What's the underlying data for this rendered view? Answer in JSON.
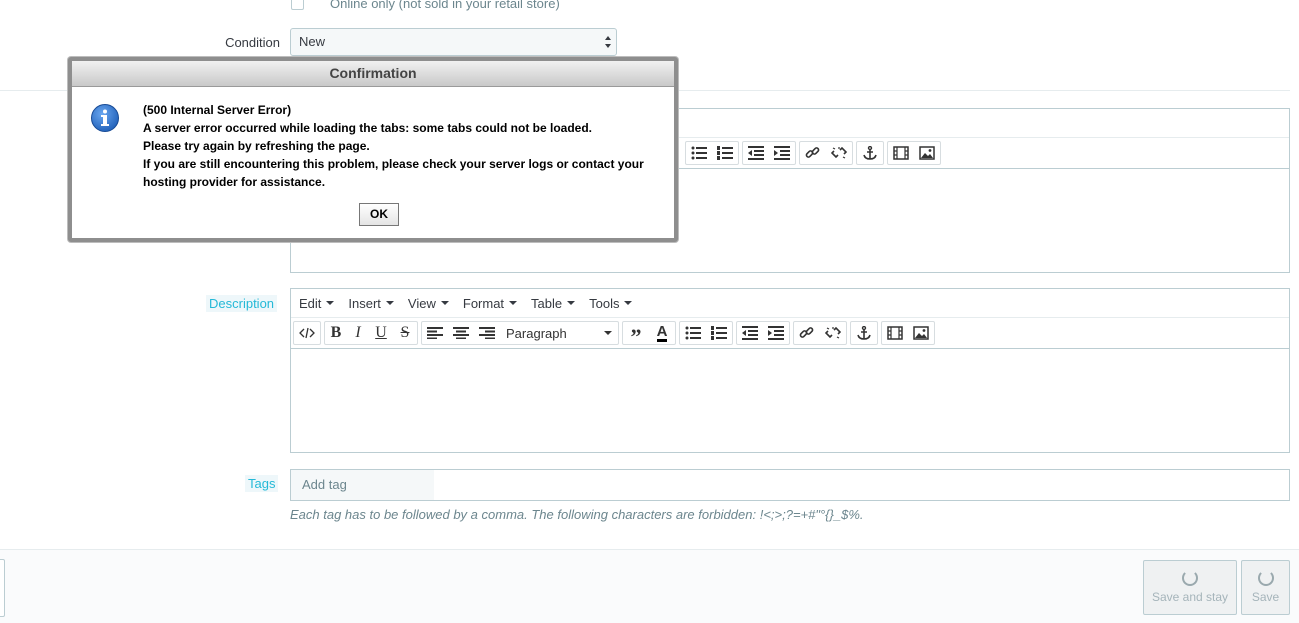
{
  "top": {
    "online_only_label": "Online only (not sold in your retail store)",
    "condition_label": "Condition",
    "condition_value": "New"
  },
  "editor_menu": [
    "Edit",
    "Insert",
    "View",
    "Format",
    "Table",
    "Tools"
  ],
  "toolbar": {
    "format_value": "Paragraph"
  },
  "description": {
    "label": "Description"
  },
  "tags": {
    "label": "Tags",
    "placeholder": "Add tag",
    "hint": "Each tag has to be followed by a comma. The following characters are forbidden: !<;>;?=+#\"°{}_$%."
  },
  "footer": {
    "save_and_stay": "Save and stay",
    "save": "Save"
  },
  "dialog": {
    "title": "Confirmation",
    "line1": "(500 Internal Server Error)",
    "line2": "A server error occurred while loading the tabs: some tabs could not be loaded.",
    "line3": "Please try again by refreshing the page.",
    "line4": "If you are still encountering this problem, please check your server logs or contact your",
    "line5": "hosting provider for assistance.",
    "ok": "OK"
  },
  "colors": {
    "accent": "#25b9d7",
    "border": "#bbcdd2",
    "info_icon": "#1f5fb8"
  }
}
